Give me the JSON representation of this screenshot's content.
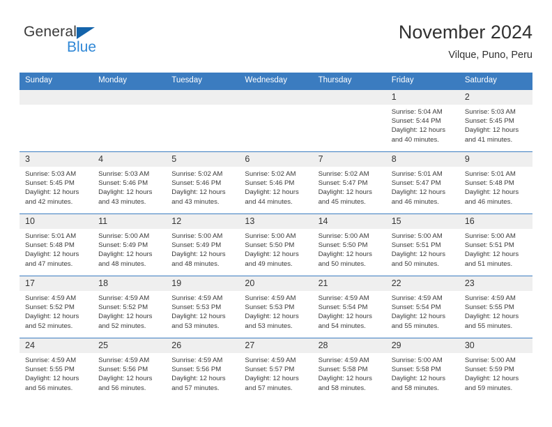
{
  "brand": {
    "name_top": "General",
    "name_bottom": "Blue"
  },
  "header": {
    "title": "November 2024",
    "subtitle": "Vilque, Puno, Peru"
  },
  "colors": {
    "header_blue": "#3b7cc0",
    "logo_blue": "#2f87d6",
    "logo_triangle": "#1464ab",
    "daynum_bg": "#efefef"
  },
  "weekday_headers": [
    "Sunday",
    "Monday",
    "Tuesday",
    "Wednesday",
    "Thursday",
    "Friday",
    "Saturday"
  ],
  "labels": {
    "sunrise_prefix": "Sunrise:",
    "sunset_prefix": "Sunset:",
    "daylight_prefix": "Daylight:"
  },
  "weeks": [
    [
      {
        "day": "",
        "sunrise": "",
        "sunset": "",
        "daylight": "",
        "empty": true
      },
      {
        "day": "",
        "sunrise": "",
        "sunset": "",
        "daylight": "",
        "empty": true
      },
      {
        "day": "",
        "sunrise": "",
        "sunset": "",
        "daylight": "",
        "empty": true
      },
      {
        "day": "",
        "sunrise": "",
        "sunset": "",
        "daylight": "",
        "empty": true
      },
      {
        "day": "",
        "sunrise": "",
        "sunset": "",
        "daylight": "",
        "empty": true
      },
      {
        "day": "1",
        "sunrise": "Sunrise: 5:04 AM",
        "sunset": "Sunset: 5:44 PM",
        "daylight": "Daylight: 12 hours and 40 minutes.",
        "empty": false
      },
      {
        "day": "2",
        "sunrise": "Sunrise: 5:03 AM",
        "sunset": "Sunset: 5:45 PM",
        "daylight": "Daylight: 12 hours and 41 minutes.",
        "empty": false
      }
    ],
    [
      {
        "day": "3",
        "sunrise": "Sunrise: 5:03 AM",
        "sunset": "Sunset: 5:45 PM",
        "daylight": "Daylight: 12 hours and 42 minutes.",
        "empty": false
      },
      {
        "day": "4",
        "sunrise": "Sunrise: 5:03 AM",
        "sunset": "Sunset: 5:46 PM",
        "daylight": "Daylight: 12 hours and 43 minutes.",
        "empty": false
      },
      {
        "day": "5",
        "sunrise": "Sunrise: 5:02 AM",
        "sunset": "Sunset: 5:46 PM",
        "daylight": "Daylight: 12 hours and 43 minutes.",
        "empty": false
      },
      {
        "day": "6",
        "sunrise": "Sunrise: 5:02 AM",
        "sunset": "Sunset: 5:46 PM",
        "daylight": "Daylight: 12 hours and 44 minutes.",
        "empty": false
      },
      {
        "day": "7",
        "sunrise": "Sunrise: 5:02 AM",
        "sunset": "Sunset: 5:47 PM",
        "daylight": "Daylight: 12 hours and 45 minutes.",
        "empty": false
      },
      {
        "day": "8",
        "sunrise": "Sunrise: 5:01 AM",
        "sunset": "Sunset: 5:47 PM",
        "daylight": "Daylight: 12 hours and 46 minutes.",
        "empty": false
      },
      {
        "day": "9",
        "sunrise": "Sunrise: 5:01 AM",
        "sunset": "Sunset: 5:48 PM",
        "daylight": "Daylight: 12 hours and 46 minutes.",
        "empty": false
      }
    ],
    [
      {
        "day": "10",
        "sunrise": "Sunrise: 5:01 AM",
        "sunset": "Sunset: 5:48 PM",
        "daylight": "Daylight: 12 hours and 47 minutes.",
        "empty": false
      },
      {
        "day": "11",
        "sunrise": "Sunrise: 5:00 AM",
        "sunset": "Sunset: 5:49 PM",
        "daylight": "Daylight: 12 hours and 48 minutes.",
        "empty": false
      },
      {
        "day": "12",
        "sunrise": "Sunrise: 5:00 AM",
        "sunset": "Sunset: 5:49 PM",
        "daylight": "Daylight: 12 hours and 48 minutes.",
        "empty": false
      },
      {
        "day": "13",
        "sunrise": "Sunrise: 5:00 AM",
        "sunset": "Sunset: 5:50 PM",
        "daylight": "Daylight: 12 hours and 49 minutes.",
        "empty": false
      },
      {
        "day": "14",
        "sunrise": "Sunrise: 5:00 AM",
        "sunset": "Sunset: 5:50 PM",
        "daylight": "Daylight: 12 hours and 50 minutes.",
        "empty": false
      },
      {
        "day": "15",
        "sunrise": "Sunrise: 5:00 AM",
        "sunset": "Sunset: 5:51 PM",
        "daylight": "Daylight: 12 hours and 50 minutes.",
        "empty": false
      },
      {
        "day": "16",
        "sunrise": "Sunrise: 5:00 AM",
        "sunset": "Sunset: 5:51 PM",
        "daylight": "Daylight: 12 hours and 51 minutes.",
        "empty": false
      }
    ],
    [
      {
        "day": "17",
        "sunrise": "Sunrise: 4:59 AM",
        "sunset": "Sunset: 5:52 PM",
        "daylight": "Daylight: 12 hours and 52 minutes.",
        "empty": false
      },
      {
        "day": "18",
        "sunrise": "Sunrise: 4:59 AM",
        "sunset": "Sunset: 5:52 PM",
        "daylight": "Daylight: 12 hours and 52 minutes.",
        "empty": false
      },
      {
        "day": "19",
        "sunrise": "Sunrise: 4:59 AM",
        "sunset": "Sunset: 5:53 PM",
        "daylight": "Daylight: 12 hours and 53 minutes.",
        "empty": false
      },
      {
        "day": "20",
        "sunrise": "Sunrise: 4:59 AM",
        "sunset": "Sunset: 5:53 PM",
        "daylight": "Daylight: 12 hours and 53 minutes.",
        "empty": false
      },
      {
        "day": "21",
        "sunrise": "Sunrise: 4:59 AM",
        "sunset": "Sunset: 5:54 PM",
        "daylight": "Daylight: 12 hours and 54 minutes.",
        "empty": false
      },
      {
        "day": "22",
        "sunrise": "Sunrise: 4:59 AM",
        "sunset": "Sunset: 5:54 PM",
        "daylight": "Daylight: 12 hours and 55 minutes.",
        "empty": false
      },
      {
        "day": "23",
        "sunrise": "Sunrise: 4:59 AM",
        "sunset": "Sunset: 5:55 PM",
        "daylight": "Daylight: 12 hours and 55 minutes.",
        "empty": false
      }
    ],
    [
      {
        "day": "24",
        "sunrise": "Sunrise: 4:59 AM",
        "sunset": "Sunset: 5:55 PM",
        "daylight": "Daylight: 12 hours and 56 minutes.",
        "empty": false
      },
      {
        "day": "25",
        "sunrise": "Sunrise: 4:59 AM",
        "sunset": "Sunset: 5:56 PM",
        "daylight": "Daylight: 12 hours and 56 minutes.",
        "empty": false
      },
      {
        "day": "26",
        "sunrise": "Sunrise: 4:59 AM",
        "sunset": "Sunset: 5:56 PM",
        "daylight": "Daylight: 12 hours and 57 minutes.",
        "empty": false
      },
      {
        "day": "27",
        "sunrise": "Sunrise: 4:59 AM",
        "sunset": "Sunset: 5:57 PM",
        "daylight": "Daylight: 12 hours and 57 minutes.",
        "empty": false
      },
      {
        "day": "28",
        "sunrise": "Sunrise: 4:59 AM",
        "sunset": "Sunset: 5:58 PM",
        "daylight": "Daylight: 12 hours and 58 minutes.",
        "empty": false
      },
      {
        "day": "29",
        "sunrise": "Sunrise: 5:00 AM",
        "sunset": "Sunset: 5:58 PM",
        "daylight": "Daylight: 12 hours and 58 minutes.",
        "empty": false
      },
      {
        "day": "30",
        "sunrise": "Sunrise: 5:00 AM",
        "sunset": "Sunset: 5:59 PM",
        "daylight": "Daylight: 12 hours and 59 minutes.",
        "empty": false
      }
    ]
  ]
}
